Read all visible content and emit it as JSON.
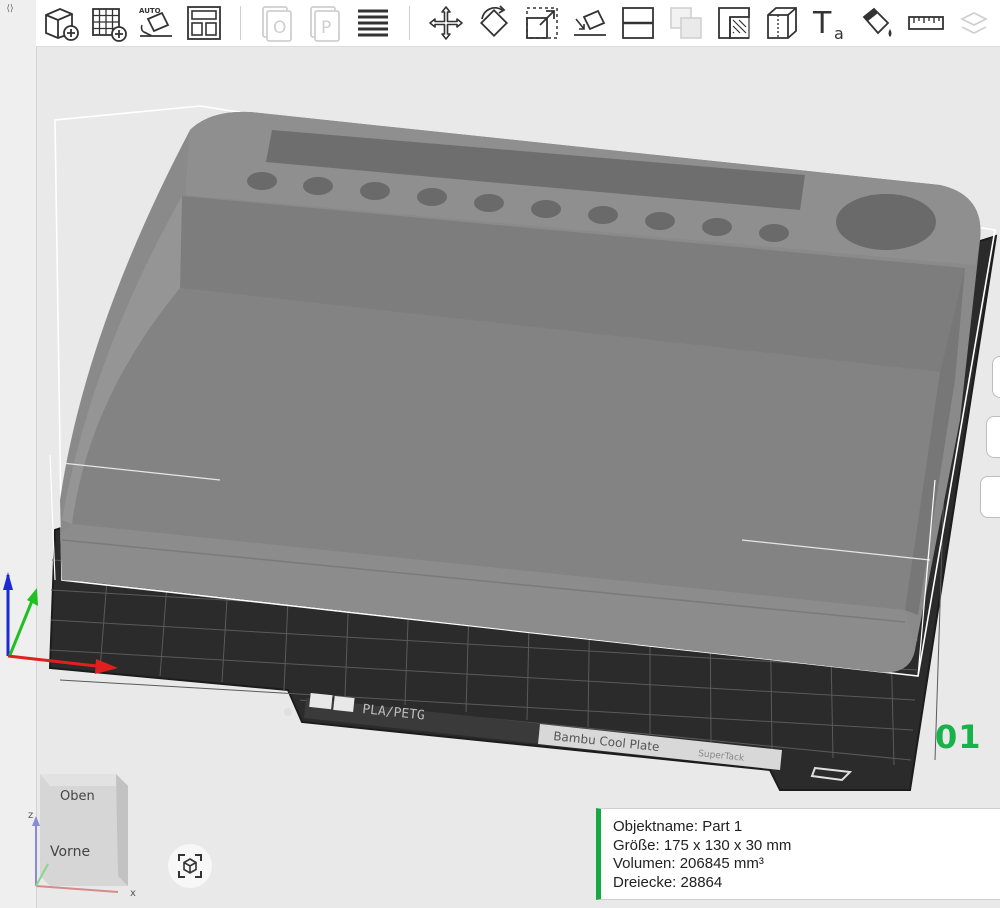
{
  "toolbar": {
    "items": [
      {
        "icon": "add-object-icon",
        "label": "Add"
      },
      {
        "icon": "add-plate-icon",
        "label": "Add plate"
      },
      {
        "icon": "auto-orient-icon",
        "label": "Auto orient",
        "text": "AUTO"
      },
      {
        "icon": "arrange-icon",
        "label": "Arrange"
      },
      {
        "icon": "split-objects-icon",
        "label": "Split to objects",
        "text": "O",
        "disabled": true
      },
      {
        "icon": "split-parts-icon",
        "label": "Split to parts",
        "text": "P",
        "disabled": true
      },
      {
        "icon": "variable-layer-height-icon",
        "label": "Variable layer height"
      },
      {
        "icon": "move-icon",
        "label": "Move"
      },
      {
        "icon": "rotate-icon",
        "label": "Rotate"
      },
      {
        "icon": "scale-icon",
        "label": "Scale"
      },
      {
        "icon": "lay-on-face-icon",
        "label": "Lay on face"
      },
      {
        "icon": "cut-icon",
        "label": "Cut"
      },
      {
        "icon": "boolean-icon",
        "label": "Mesh boolean",
        "disabled": true
      },
      {
        "icon": "support-painting-icon",
        "label": "Support painting"
      },
      {
        "icon": "seam-painting-icon",
        "label": "Seam painting"
      },
      {
        "icon": "text-shape-icon",
        "label": "Text shape",
        "text": "T",
        "subtext": "a"
      },
      {
        "icon": "color-painting-icon",
        "label": "Color painting"
      },
      {
        "icon": "measure-icon",
        "label": "Measure"
      },
      {
        "icon": "assembly-icon",
        "label": "Assembly",
        "disabled": true
      }
    ]
  },
  "plate": {
    "material_label": "PLA/PETG",
    "plate_name": "Bambu Cool Plate",
    "plate_sub": "SuperTack",
    "plate_number": "01"
  },
  "view_cube": {
    "top_label": "Oben",
    "front_label": "Vorne",
    "axis_z": "z",
    "axis_x": "x"
  },
  "object_info": {
    "name": "Objektname: Part 1",
    "size": "Größe: 175 x 130 x 30 mm",
    "volume": "Volumen: 206845 mm³",
    "triangles": "Dreiecke: 28864"
  },
  "colors": {
    "accent": "#17a846",
    "plate": "#2b2b2b",
    "model": "#8a8a8a",
    "axis_x": "#e02020",
    "axis_y": "#20c020",
    "axis_z": "#1a2bd6"
  }
}
